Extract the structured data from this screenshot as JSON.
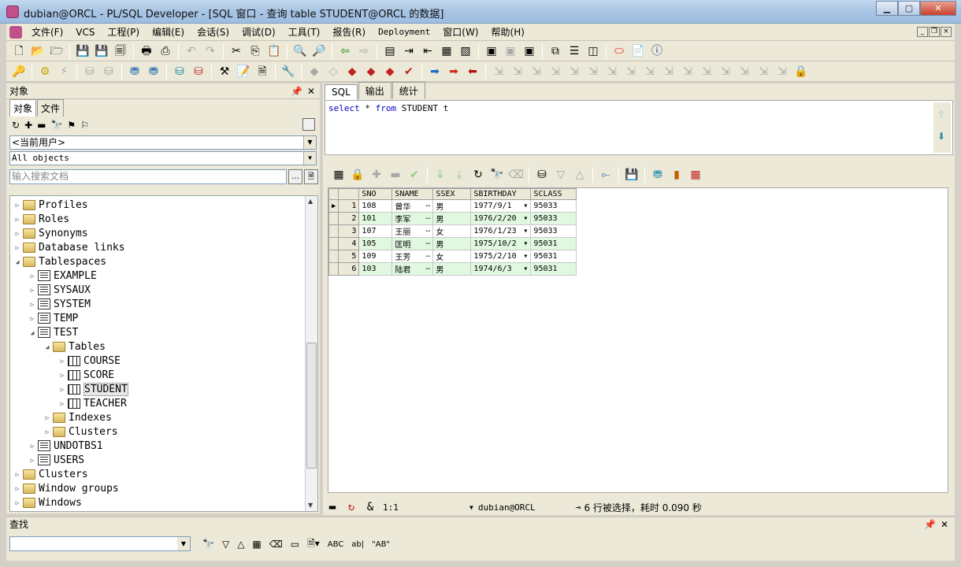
{
  "window": {
    "title": "dubian@ORCL - PL/SQL Developer - [SQL 窗口 - 查询 table STUDENT@ORCL 的数据]"
  },
  "menu": [
    "文件(F)",
    "VCS",
    "工程(P)",
    "编辑(E)",
    "会话(S)",
    "调试(D)",
    "工具(T)",
    "报告(R)",
    "Deployment",
    "窗口(W)",
    "帮助(H)"
  ],
  "left": {
    "title": "对象",
    "tabs": [
      "对象",
      "文件"
    ],
    "user_combo": "<当前用户>",
    "filter_combo": "All objects",
    "search_placeholder": "输入搜索文档",
    "tree": [
      {
        "label": "Profiles",
        "level": 0,
        "icon": "folder"
      },
      {
        "label": "Roles",
        "level": 0,
        "icon": "folder"
      },
      {
        "label": "Synonyms",
        "level": 0,
        "icon": "folder"
      },
      {
        "label": "Database links",
        "level": 0,
        "icon": "folder"
      },
      {
        "label": "Tablespaces",
        "level": 0,
        "icon": "folder-open"
      },
      {
        "label": "EXAMPLE",
        "level": 1,
        "icon": "tablespace"
      },
      {
        "label": "SYSAUX",
        "level": 1,
        "icon": "tablespace"
      },
      {
        "label": "SYSTEM",
        "level": 1,
        "icon": "tablespace"
      },
      {
        "label": "TEMP",
        "level": 1,
        "icon": "tablespace"
      },
      {
        "label": "TEST",
        "level": 1,
        "icon": "tablespace"
      },
      {
        "label": "Tables",
        "level": 2,
        "icon": "folder-open"
      },
      {
        "label": "COURSE",
        "level": 3,
        "icon": "table"
      },
      {
        "label": "SCORE",
        "level": 3,
        "icon": "table"
      },
      {
        "label": "STUDENT",
        "level": 3,
        "icon": "table"
      },
      {
        "label": "TEACHER",
        "level": 3,
        "icon": "table"
      },
      {
        "label": "Indexes",
        "level": 2,
        "icon": "folder"
      },
      {
        "label": "Clusters",
        "level": 2,
        "icon": "folder"
      },
      {
        "label": "UNDOTBS1",
        "level": 1,
        "icon": "tablespace"
      },
      {
        "label": "USERS",
        "level": 1,
        "icon": "tablespace"
      },
      {
        "label": "Clusters",
        "level": 0,
        "icon": "folder"
      },
      {
        "label": "Window groups",
        "level": 0,
        "icon": "folder"
      },
      {
        "label": "Windows",
        "level": 0,
        "icon": "folder"
      }
    ]
  },
  "editor": {
    "tabs": [
      "SQL",
      "输出",
      "统计"
    ],
    "sql_keyword1": "select",
    "sql_star": " * ",
    "sql_keyword2": "from",
    "sql_rest": " STUDENT t"
  },
  "grid": {
    "columns": [
      "SNO",
      "SNAME",
      "SSEX",
      "SBIRTHDAY",
      "SCLASS"
    ],
    "rows": [
      {
        "n": "1",
        "sno": "108",
        "sname": "曾华",
        "ssex": "男",
        "birth": "1977/9/1",
        "sclass": "95033"
      },
      {
        "n": "2",
        "sno": "101",
        "sname": "李军",
        "ssex": "男",
        "birth": "1976/2/20",
        "sclass": "95033"
      },
      {
        "n": "3",
        "sno": "107",
        "sname": "王丽",
        "ssex": "女",
        "birth": "1976/1/23",
        "sclass": "95033"
      },
      {
        "n": "4",
        "sno": "105",
        "sname": "匡明",
        "ssex": "男",
        "birth": "1975/10/2",
        "sclass": "95031"
      },
      {
        "n": "5",
        "sno": "109",
        "sname": "王芳",
        "ssex": "女",
        "birth": "1975/2/10",
        "sclass": "95031"
      },
      {
        "n": "6",
        "sno": "103",
        "sname": "陆君",
        "ssex": "男",
        "birth": "1974/6/3",
        "sclass": "95031"
      }
    ]
  },
  "status": {
    "position": "1:1",
    "connection": "dubian@ORCL",
    "message": "6 行被选择，耗时 0.090 秒"
  },
  "find": {
    "title": "查找"
  }
}
